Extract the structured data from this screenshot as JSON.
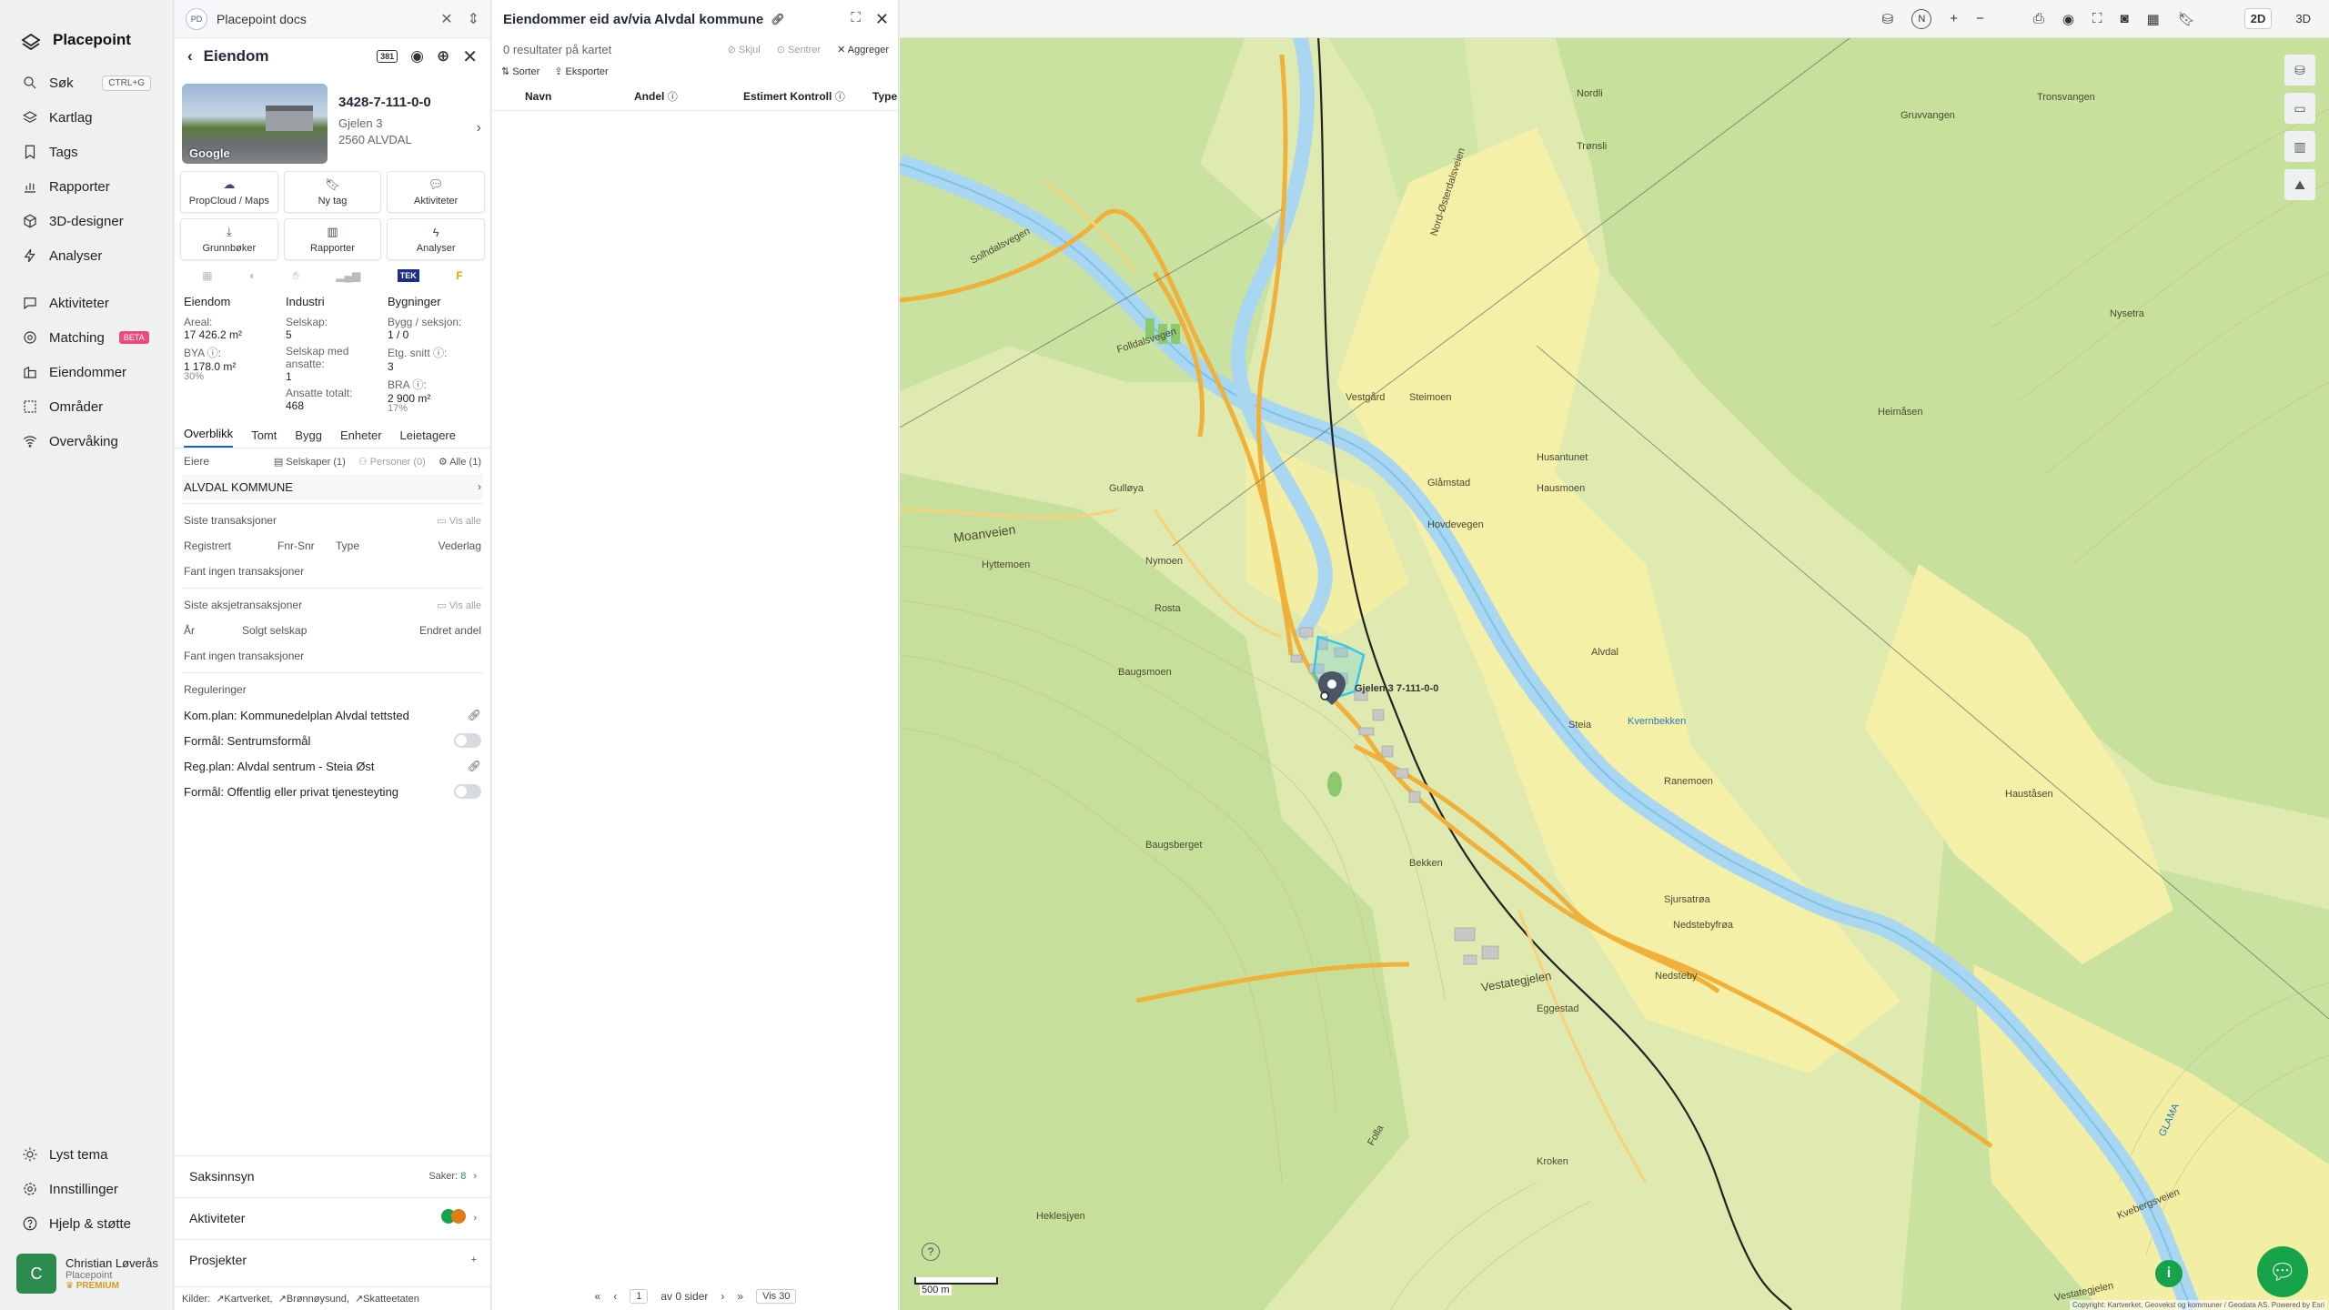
{
  "app": {
    "brand": "Placepoint"
  },
  "nav": {
    "items": [
      {
        "label": "Søk",
        "icon": "search-icon",
        "shortcut": "CTRL+G"
      },
      {
        "label": "Kartlag",
        "icon": "layers-icon"
      },
      {
        "label": "Tags",
        "icon": "bookmark-icon"
      },
      {
        "label": "Rapporter",
        "icon": "chart-icon"
      },
      {
        "label": "3D-designer",
        "icon": "cube-icon"
      },
      {
        "label": "Analyser",
        "icon": "bolt-icon"
      }
    ],
    "items2": [
      {
        "label": "Aktiviteter",
        "icon": "chat-icon"
      },
      {
        "label": "Matching",
        "icon": "matching-icon",
        "badge": "BETA"
      },
      {
        "label": "Eiendommer",
        "icon": "buildings-icon"
      },
      {
        "label": "Områder",
        "icon": "area-icon"
      },
      {
        "label": "Overvåking",
        "icon": "wifi-icon"
      }
    ],
    "bottom": [
      {
        "label": "Lyst tema",
        "icon": "sun-icon"
      },
      {
        "label": "Innstillinger",
        "icon": "gear-icon"
      },
      {
        "label": "Hjelp & støtte",
        "icon": "help-icon"
      }
    ],
    "user": {
      "initial": "C",
      "name": "Christian Løverås",
      "org": "Placepoint",
      "plan": "PREMIUM"
    }
  },
  "docs": {
    "badge": "PD",
    "title": "Placepoint docs"
  },
  "property": {
    "panel_title": "Eiendom",
    "badge": "381",
    "id": "3428-7-111-0-0",
    "street": "Gjelen 3",
    "postal": "2560 ALVDAL",
    "photo_credit": "Google",
    "actions": [
      {
        "label": "PropCloud / Maps",
        "icon": "cloud-icon"
      },
      {
        "label": "Ny tag",
        "icon": "bookmark-icon"
      },
      {
        "label": "Aktiviteter",
        "icon": "chat-icon"
      },
      {
        "label": "Grunnbøker",
        "icon": "download-icon"
      },
      {
        "label": "Rapporter",
        "icon": "chart-icon"
      },
      {
        "label": "Analyser",
        "icon": "bolt-icon"
      }
    ],
    "sources": [
      "TEK"
    ],
    "facts": {
      "col1": {
        "head": "Eiendom",
        "areal_label": "Areal:",
        "areal": "17 426.2 m²",
        "bya_label": "BYA ⓘ:",
        "bya": "1 178.0 m²",
        "bya_pct": "30%"
      },
      "col2": {
        "head": "Industri",
        "selskap_label": "Selskap:",
        "selskap": "5",
        "ansatte_label": "Selskap med ansatte:",
        "ansatte": "1",
        "tot_label": "Ansatte totalt:",
        "tot": "468"
      },
      "col3": {
        "head": "Bygninger",
        "bygg_label": "Bygg / seksjon:",
        "bygg": "1 / 0",
        "etg_label": "Etg. snitt ⓘ:",
        "etg": "3",
        "bra_label": "BRA ⓘ:",
        "bra": "2 900 m²",
        "bra_pct": "17%"
      }
    },
    "tabs": [
      "Overblikk",
      "Tomt",
      "Bygg",
      "Enheter",
      "Leietagere"
    ],
    "owners": {
      "label": "Eiere",
      "filters": [
        "Selskaper (1)",
        "Personer (0)",
        "Alle (1)"
      ],
      "name": "ALVDAL KOMMUNE"
    },
    "transactions": {
      "label": "Siste transaksjoner",
      "show_all": "Vis alle",
      "cols": [
        "Registrert",
        "Fnr-Snr",
        "Type",
        "Vederlag"
      ],
      "empty": "Fant ingen transaksjoner"
    },
    "share_tx": {
      "label": "Siste aksjetransaksjoner",
      "show_all": "Vis alle",
      "cols": [
        "År",
        "Solgt selskap",
        "Endret andel"
      ],
      "empty": "Fant ingen transaksjoner"
    },
    "regulations": {
      "label": "Reguleringer",
      "items": [
        {
          "text": "Kom.plan: Kommunedelplan Alvdal tettsted",
          "kind": "link"
        },
        {
          "text": "Formål: Sentrumsformål",
          "kind": "toggle"
        },
        {
          "text": "Reg.plan: Alvdal sentrum - Steia Øst",
          "kind": "link"
        },
        {
          "text": "Formål: Offentlig eller privat tjenesteyting",
          "kind": "toggle"
        }
      ]
    },
    "accordions": [
      {
        "label": "Saksinnsyn",
        "meta": "Saker:",
        "count": "8"
      },
      {
        "label": "Aktiviteter"
      },
      {
        "label": "Prosjekter",
        "meta": "+"
      }
    ],
    "kilder": {
      "label": "Kilder:",
      "items": [
        "Kartverket",
        "Brønnøysund",
        "Skatteetaten"
      ]
    }
  },
  "list": {
    "title": "Eiendommer eid av/via Alvdal kommune",
    "results": "0 resultater på kartet",
    "actions": [
      "Skjul",
      "Sentrer",
      "Aggreger"
    ],
    "tools": [
      "Sorter",
      "Eksporter"
    ],
    "cols": [
      "Navn",
      "Andel",
      "Estimert Kontroll",
      "Type"
    ],
    "pager": {
      "page": "1",
      "of": "av 0 sider",
      "per": "Vis 30"
    }
  },
  "map": {
    "toolbar": {
      "mode2d": "2D",
      "mode3d": "3D"
    },
    "scale": "500 m",
    "attribution": "Copyright: Kartverket, Geovekst og kommuner / Geodata AS. Powered by Esri",
    "labels": [
      "Solhdalsvegen",
      "Folldalsvegen",
      "Moanveien",
      "Nord-Østerdalsveien",
      "Vestategjelen",
      "Kvebergsveien",
      "Vestategjelen",
      "Gjelen 3 7-111-0-0",
      "Baugsmoen",
      "Baugsberget",
      "Folla",
      "GLAMA",
      "Alvdal",
      "Steia",
      "Ranemoen",
      "Bekken",
      "Hyttemoen",
      "Nymoen",
      "Rosta",
      "Gulløya",
      "Steimoen",
      "Glåmstad",
      "Husantunet",
      "Kvernbekken",
      "Nedstebyfrøa",
      "Nedsteby",
      "Eggestad",
      "Hovdevegen",
      "Sjursatrøa",
      "Hauståsen",
      "Heimåsen",
      "Nysetra",
      "Tronsvangen",
      "Gruvvangen",
      "Nordli",
      "Trønsli",
      "Vestgård",
      "Hausmoen",
      "Heklesjyen",
      "Kroken"
    ]
  }
}
